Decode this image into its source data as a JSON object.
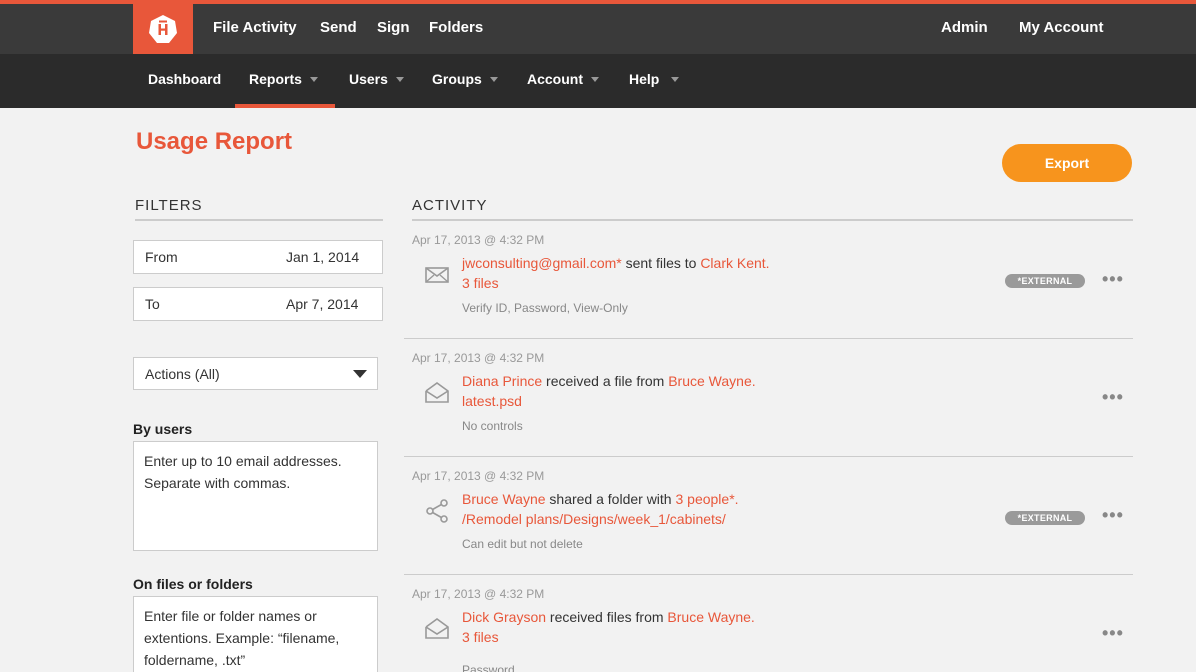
{
  "topnav": {
    "logo_icon": "hightail-logo",
    "items": [
      "File Activity",
      "Send",
      "Sign",
      "Folders"
    ],
    "right": [
      "Admin",
      "My Account"
    ]
  },
  "subnav": {
    "items": [
      {
        "label": "Dashboard",
        "dropdown": false
      },
      {
        "label": "Reports",
        "dropdown": true,
        "active": true
      },
      {
        "label": "Users",
        "dropdown": true
      },
      {
        "label": "Groups",
        "dropdown": true
      },
      {
        "label": "Account",
        "dropdown": true
      },
      {
        "label": "Help",
        "dropdown": true
      }
    ]
  },
  "page": {
    "title": "Usage Report",
    "export_label": "Export"
  },
  "filters": {
    "heading": "FILTERS",
    "from_label": "From",
    "from_value": "Jan 1, 2014",
    "to_label": "To",
    "to_value": "Apr 7, 2014",
    "actions_value": "Actions (All)",
    "by_users_label": "By users",
    "by_users_placeholder": "Enter up to 10 email addresses. Separate with commas.",
    "files_label": "On files or folders",
    "files_placeholder": "Enter file or folder names or extentions. Example: “filename, foldername, .txt”"
  },
  "activity": {
    "heading": "ACTIVITY",
    "items": [
      {
        "time": "Apr 17, 2013 @ 4:32 PM",
        "icon": "envelope-icon",
        "actor": "jwconsulting@gmail.com*",
        "verb": " sent files to ",
        "target": "Clark Kent.",
        "object": "3 files",
        "details": "Verify ID, Password, View-Only",
        "badge": "*EXTERNAL"
      },
      {
        "time": "Apr 17, 2013 @ 4:32 PM",
        "icon": "envelope-open-icon",
        "actor": "Diana Prince",
        "verb": " received a file from ",
        "target": "Bruce Wayne.",
        "object": "latest.psd",
        "details": "No controls",
        "badge": ""
      },
      {
        "time": "Apr 17, 2013 @ 4:32 PM",
        "icon": "share-icon",
        "actor": "Bruce Wayne",
        "verb": " shared a folder with ",
        "target": "3 people*.",
        "object": "/Remodel plans/Designs/week_1/cabinets/",
        "details": "Can edit but not delete",
        "badge": "*EXTERNAL"
      },
      {
        "time": "Apr 17, 2013 @ 4:32 PM",
        "icon": "envelope-open-icon",
        "actor": "Dick Grayson",
        "verb": " received files from ",
        "target": "Bruce Wayne.",
        "object": "3 files",
        "details": "Password",
        "badge": ""
      }
    ],
    "more_label": "•••"
  },
  "colors": {
    "accent": "#e8573a",
    "export": "#f7941d",
    "topbar": "#3a3a3a",
    "subbar": "#2b2b2b"
  }
}
